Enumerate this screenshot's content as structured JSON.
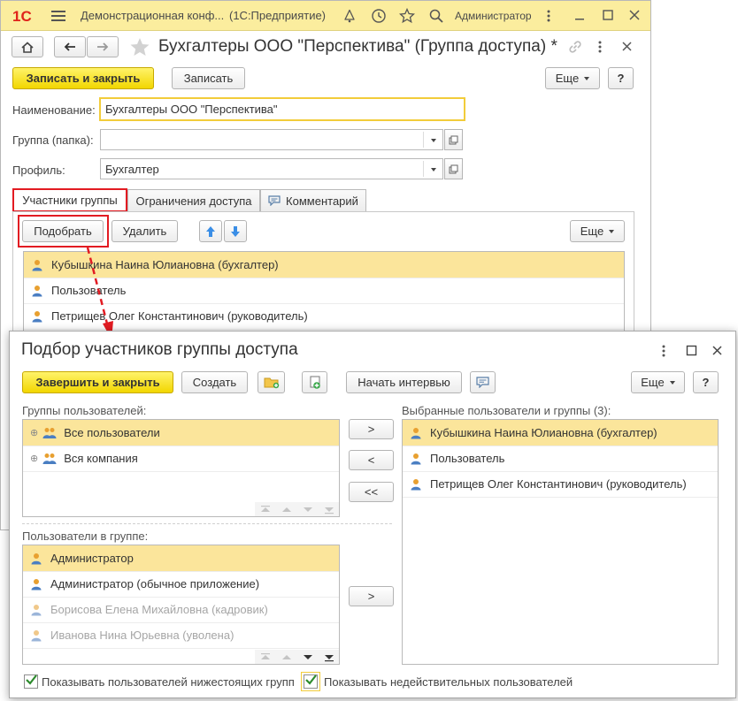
{
  "app": {
    "logo_text": "1С",
    "title": "Демонстрационная конф...",
    "platform": "(1С:Предприятие)",
    "user": "Администратор"
  },
  "form": {
    "title": "Бухгалтеры ООО \"Перспектива\" (Группа доступа) *",
    "save_close": "Записать и закрыть",
    "save": "Записать",
    "more": "Еще",
    "help": "?",
    "name_label": "Наименование:",
    "name_value": "Бухгалтеры ООО \"Перспектива\"",
    "group_label": "Группа (папка):",
    "group_value": "",
    "profile_label": "Профиль:",
    "profile_value": "Бухгалтер",
    "tabs": [
      "Участники группы",
      "Ограничения доступа",
      "Комментарий"
    ],
    "pick": "Подобрать",
    "delete": "Удалить",
    "members": [
      "Кубышкина Наина Юлиановна (бухгалтер)",
      "Пользователь",
      "Петрищев Олег Константинович (руководитель)"
    ]
  },
  "dialog": {
    "title": "Подбор участников группы доступа",
    "finish": "Завершить и закрыть",
    "create": "Создать",
    "interview": "Начать интервью",
    "more": "Еще",
    "help": "?",
    "groups_label": "Группы пользователей:",
    "groups": [
      "Все пользователи",
      "Вся компания"
    ],
    "selected_label": "Выбранные пользователи и группы (3):",
    "selected": [
      "Кубышкина Наина Юлиановна (бухгалтер)",
      "Пользователь",
      "Петрищев Олег Константинович (руководитель)"
    ],
    "users_label": "Пользователи в группе:",
    "users": [
      {
        "name": "Администратор",
        "dim": false
      },
      {
        "name": "Администратор (обычное приложение)",
        "dim": false
      },
      {
        "name": "Борисова Елена Михайловна (кадровик)",
        "dim": true
      },
      {
        "name": "Иванова Нина Юрьевна (уволена)",
        "dim": true
      }
    ],
    "add": ">",
    "remove": "<",
    "remove_all": "<<",
    "add_users": ">",
    "show_subgroups": "Показывать пользователей нижестоящих групп",
    "show_inactive": "Показывать недействительных пользователей"
  },
  "colors": {
    "accent_yellow": "#f2d600",
    "title_bar": "#fbed9e",
    "selection": "#fbe59b",
    "highlight_red": "#e21b22",
    "user_icon": "#e8a030",
    "arrow_blue": "#3a8ee6"
  }
}
